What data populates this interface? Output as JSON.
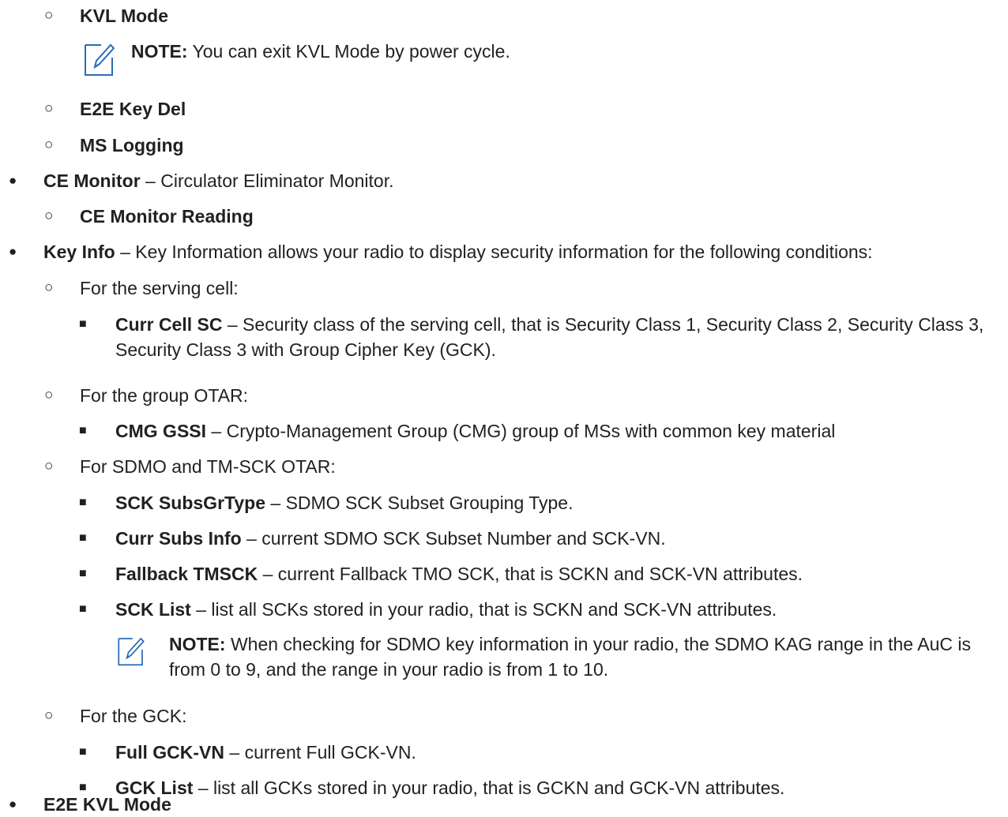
{
  "glyphs": {
    "level1": "●",
    "level2": "○",
    "level3": "■"
  },
  "icons": {
    "note": "note-pencil-icon",
    "note_color": "#2a6db5"
  },
  "items": [
    {
      "term": "KVL Mode"
    },
    {
      "note_label": "NOTE:",
      "note_text": " You can exit KVL Mode by power cycle."
    },
    {
      "term": "E2E Key Del"
    },
    {
      "term": "MS Logging"
    },
    {
      "term": "CE Monitor",
      "desc": " – Circulator Eliminator Monitor."
    },
    {
      "term": "CE Monitor Reading"
    },
    {
      "term": "Key Info",
      "desc": " – Key Information allows your radio to display security information for the following conditions:"
    },
    {
      "text": "For the serving cell:"
    },
    {
      "term": "Curr Cell SC",
      "desc": " – Security class of the serving cell, that is Security Class 1, Security Class 2, Security Class 3, Security Class 3 with Group Cipher Key (GCK)."
    },
    {
      "text": "For the group OTAR:"
    },
    {
      "term": "CMG GSSI",
      "desc": " – Crypto-Management Group (CMG) group of MSs with common key material"
    },
    {
      "text": "For SDMO and TM-SCK OTAR:"
    },
    {
      "term": "SCK SubsGrType",
      "desc": " – SDMO SCK Subset Grouping Type."
    },
    {
      "term": "Curr Subs Info",
      "desc": " – current SDMO SCK Subset Number and SCK-VN."
    },
    {
      "term": "Fallback TMSCK",
      "desc": " – current Fallback TMO SCK, that is SCKN and SCK-VN attributes."
    },
    {
      "term": "SCK List",
      "desc": " – list all SCKs stored in your radio, that is SCKN and SCK-VN attributes."
    },
    {
      "note_label": "NOTE:",
      "note_text": " When checking for SDMO key information in your radio, the SDMO KAG range in the AuC is from 0 to 9, and the range in your radio is from 1 to 10."
    },
    {
      "text": "For the GCK:"
    },
    {
      "term": "Full GCK-VN",
      "desc": " – current Full GCK-VN."
    },
    {
      "term": "GCK List",
      "desc": " – list all GCKs stored in your radio, that is GCKN and GCK-VN attributes."
    },
    {
      "term": "E2E KVL Mode"
    }
  ]
}
